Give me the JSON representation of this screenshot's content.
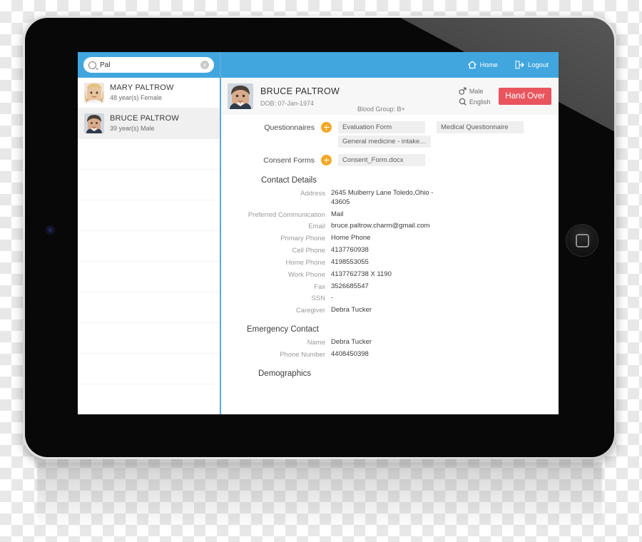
{
  "device": {
    "name": "tablet",
    "home_button_icon": "rounded-square-icon",
    "camera_icon": "front-camera-icon"
  },
  "sidebar": {
    "search": {
      "value": "Pal",
      "placeholder": "Search",
      "search_icon": "search-icon",
      "clear_icon": "clear-circle-icon",
      "clear_glyph": "×"
    },
    "patients": [
      {
        "name": "MARY PALTROW",
        "meta": "48 year(s)  Female",
        "selected": false
      },
      {
        "name": "BRUCE PALTROW",
        "meta": "39 year(s)  Male",
        "selected": true
      }
    ],
    "empty_row_count": 9
  },
  "topbar": {
    "home_label": "Home",
    "home_icon": "home-icon",
    "logout_label": "Logout",
    "logout_icon": "logout-icon"
  },
  "patient": {
    "name": "BRUCE PALTROW",
    "dob": "DOB: 07-Jan-1974",
    "blood_group": "Blood Group: B+",
    "gender": "Male",
    "gender_icon": "male-icon",
    "language": "English",
    "language_icon": "language-icon",
    "hand_over_label": "Hand Over",
    "photo_icon": "patient-photo"
  },
  "forms": {
    "questionnaires_label": "Questionnaires",
    "questionnaires": [
      [
        "Evaluation Form",
        "Medical Questionnaire"
      ],
      [
        "General medicine - intake…"
      ]
    ],
    "consent_label": "Consent Forms",
    "consent_forms": [
      [
        "Consent_Form.docx"
      ]
    ],
    "add_icon": "plus-icon"
  },
  "contact_details": {
    "title": "Contact Details",
    "rows": [
      {
        "label": "Address",
        "value": "2645 Mulberry Lane  Toledo,Ohio - 43605"
      },
      {
        "label": "Preferred Communication",
        "value": "Mail"
      },
      {
        "label": "Email",
        "value": "bruce.paltrow.charm@gmail.com"
      },
      {
        "label": "Primary Phone",
        "value": "Home Phone"
      },
      {
        "label": "Cell Phone",
        "value": "4137760938"
      },
      {
        "label": "Home Phone",
        "value": "4198553055"
      },
      {
        "label": "Work Phone",
        "value": "4137762738 X 1190"
      },
      {
        "label": "Fax",
        "value": "3526685547"
      },
      {
        "label": "SSN",
        "value": "-"
      },
      {
        "label": "Caregiver",
        "value": "Debra Tucker"
      }
    ]
  },
  "emergency_contact": {
    "title": "Emergency Contact",
    "rows": [
      {
        "label": "Name",
        "value": "Debra Tucker"
      },
      {
        "label": "Phone Number",
        "value": "4408450398"
      }
    ]
  },
  "demographics": {
    "title": "Demographics"
  },
  "colors": {
    "accent_blue": "#41a6de",
    "danger_red": "#e8555e",
    "plus_orange": "#f5a623",
    "chip_gray": "#efefef"
  }
}
